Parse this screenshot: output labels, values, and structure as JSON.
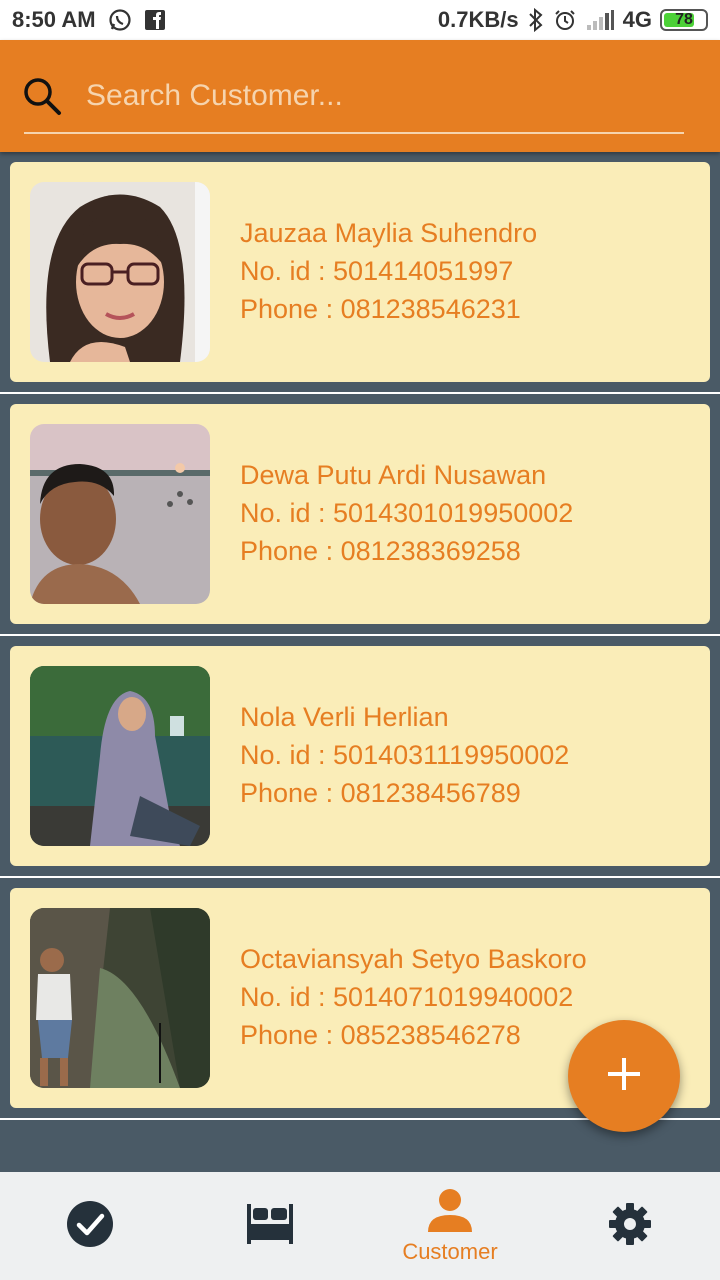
{
  "status_bar": {
    "time": "8:50 AM",
    "network_speed": "0.7KB/s",
    "network_type": "4G",
    "battery": "78",
    "left_icons": [
      "whatsapp-icon",
      "facebook-icon"
    ],
    "right_icons": [
      "bluetooth-icon",
      "alarm-icon",
      "signal-icon"
    ]
  },
  "header": {
    "search_placeholder": "Search Customer...",
    "search_icon": "search-icon",
    "color": "#e67e22"
  },
  "customers": [
    {
      "name": "Jauzaa Maylia Suhendro",
      "id_text": "No. id : 501414051997",
      "phone_text": "Phone : 081238546231"
    },
    {
      "name": "Dewa Putu Ardi Nusawan",
      "id_text": "No. id : 5014301019950002",
      "phone_text": "Phone : 081238369258"
    },
    {
      "name": "Nola Verli Herlian",
      "id_text": "No. id : 5014031119950002",
      "phone_text": "Phone : 081238456789"
    },
    {
      "name": "Octaviansyah Setyo Baskoro",
      "id_text": "No. id : 5014071019940002",
      "phone_text": "Phone : 085238546278"
    }
  ],
  "fab": {
    "icon": "plus-icon"
  },
  "bottom_nav": {
    "items": [
      {
        "icon": "check-circle-icon",
        "label": ""
      },
      {
        "icon": "bed-icon",
        "label": ""
      },
      {
        "icon": "person-icon",
        "label": "Customer",
        "active": true
      },
      {
        "icon": "gear-icon",
        "label": ""
      }
    ]
  },
  "colors": {
    "accent": "#e67e22",
    "card": "#faedb8",
    "list_background": "#4a5a66",
    "nav_icon": "#25313b"
  }
}
